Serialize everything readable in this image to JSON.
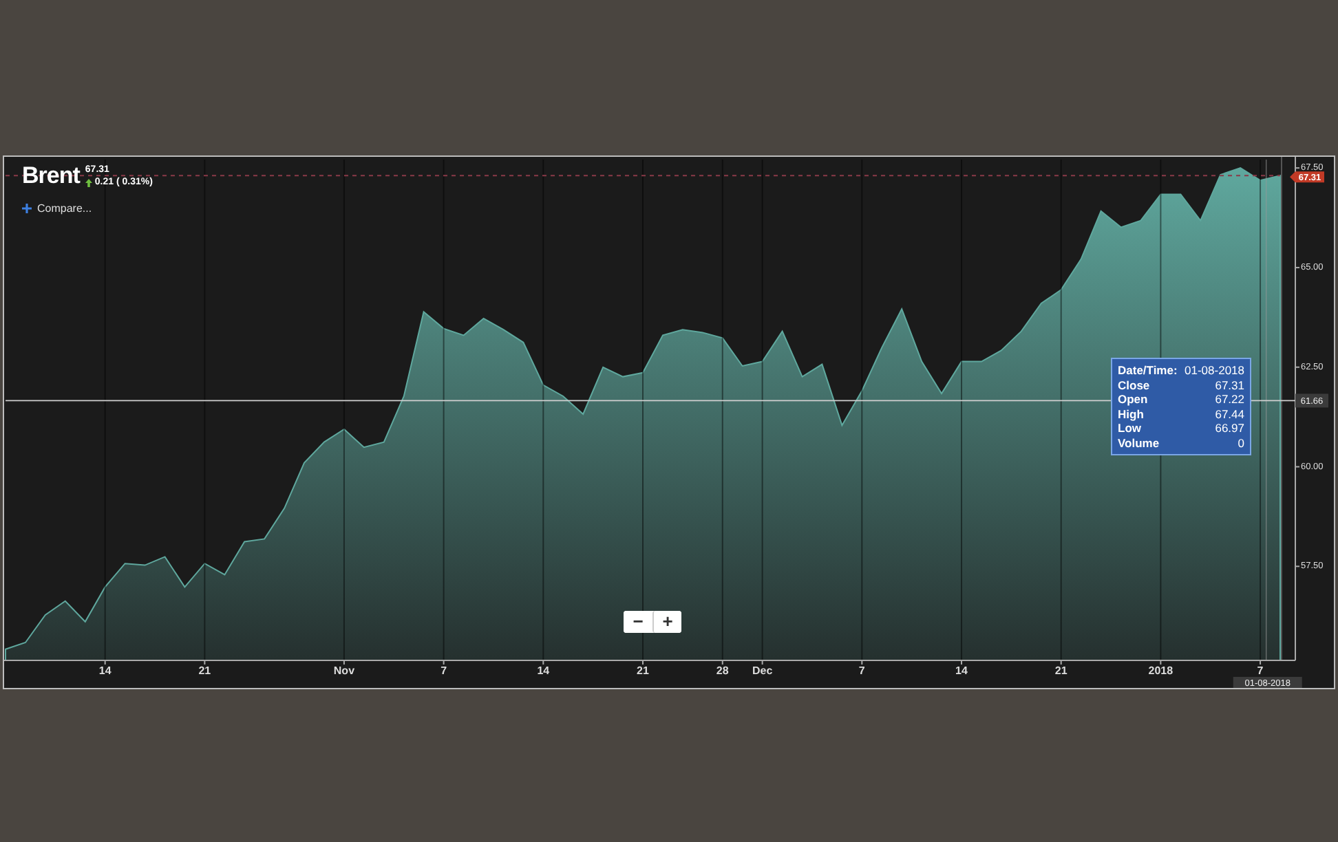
{
  "instrument": {
    "name": "Brent",
    "price": "67.31",
    "change": "0.21 ( 0.31%)",
    "rising": true
  },
  "compare": {
    "label": "Compare..."
  },
  "crosshair": {
    "date": "01-08-2018"
  },
  "tooltip": {
    "rows": [
      {
        "label": "Date/Time:",
        "value": "01-08-2018"
      },
      {
        "label": "Close",
        "value": "67.31"
      },
      {
        "label": "Open",
        "value": "67.22"
      },
      {
        "label": "High",
        "value": "67.44"
      },
      {
        "label": "Low",
        "value": "66.97"
      },
      {
        "label": "Volume",
        "value": "0"
      }
    ]
  },
  "zoom_buttons": [
    "−",
    "+"
  ],
  "chart_data": {
    "type": "area",
    "categories": [
      null,
      null,
      null,
      null,
      null,
      "14",
      null,
      null,
      null,
      null,
      "21",
      null,
      null,
      null,
      null,
      null,
      null,
      "Nov",
      null,
      null,
      null,
      null,
      "7",
      null,
      null,
      null,
      null,
      "14",
      null,
      null,
      null,
      null,
      "21",
      null,
      null,
      null,
      "28",
      null,
      "Dec",
      null,
      null,
      null,
      null,
      "7",
      null,
      null,
      null,
      null,
      "14",
      null,
      null,
      null,
      null,
      "21",
      null,
      null,
      null,
      null,
      "2018",
      null,
      null,
      null,
      null,
      "7",
      null
    ],
    "series": [
      {
        "color": "#5fa89e",
        "values": [
          55.42,
          55.59,
          56.28,
          56.63,
          56.11,
          56.98,
          57.57,
          57.53,
          57.74,
          56.98,
          57.57,
          57.29,
          58.12,
          58.19,
          58.96,
          60.1,
          60.62,
          60.94,
          60.49,
          60.62,
          61.77,
          63.89,
          63.47,
          63.3,
          63.72,
          63.44,
          63.12,
          62.05,
          61.77,
          61.32,
          62.5,
          62.26,
          62.36,
          63.3,
          63.44,
          63.37,
          63.23,
          62.53,
          62.64,
          63.4,
          62.26,
          62.57,
          61.04,
          61.91,
          62.99,
          63.96,
          62.64,
          61.84,
          62.64,
          62.64,
          62.92,
          63.4,
          64.1,
          64.44,
          65.21,
          66.42,
          66.01,
          66.18,
          66.84,
          66.84,
          66.18,
          67.33,
          67.5,
          67.19,
          67.31
        ]
      }
    ],
    "ylim": [
      55.14,
      67.71
    ],
    "grid": true,
    "ref_lines": [
      {
        "axis": "y",
        "value": 67.31,
        "label": "67.31",
        "color": "#8a3a48"
      },
      {
        "axis": "y",
        "value": 61.66,
        "label": "61.66",
        "color": "#cfcfcf"
      }
    ],
    "yticks": [
      {
        "value": 57.5,
        "label": "57.50"
      },
      {
        "value": 60,
        "label": "60.00"
      },
      {
        "value": 62.5,
        "label": "62.50"
      },
      {
        "value": 65,
        "label": "65.00"
      },
      {
        "value": 67.5,
        "label": "67.50"
      }
    ]
  }
}
